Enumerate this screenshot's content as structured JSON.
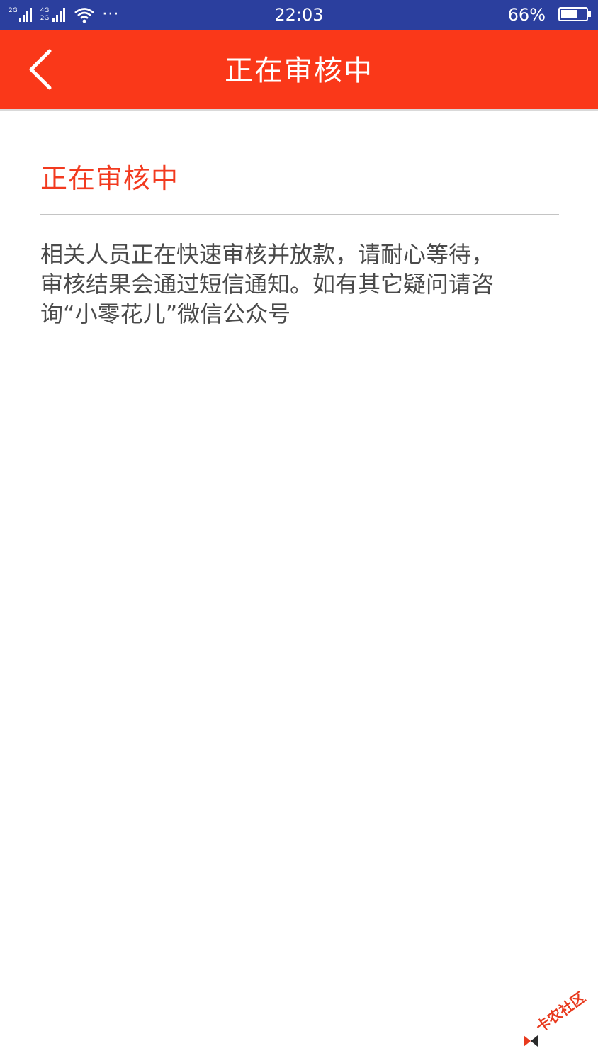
{
  "status_bar": {
    "network_1": "2G",
    "network_2_top": "4G",
    "network_2_bottom": "2G",
    "more": "···",
    "time": "22:03",
    "battery_pct": "66%",
    "battery_level": 0.66
  },
  "header": {
    "title": "正在审核中"
  },
  "content": {
    "heading": "正在审核中",
    "message": "相关人员正在快速审核并放款，请耐心等待，\n审核结果会通过短信通知。如有其它疑问请咨\n询“小零花儿”微信公众号"
  },
  "watermark": {
    "text": "卡农社区"
  },
  "colors": {
    "status_bar": "#2b3f9e",
    "header": "#fa3819",
    "heading": "#f23a1f",
    "text": "#4a4a4a"
  }
}
